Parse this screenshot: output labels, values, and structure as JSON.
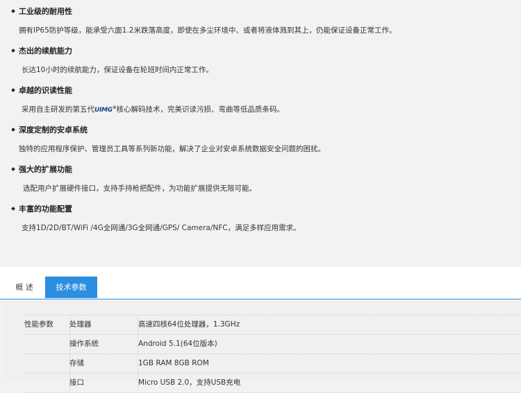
{
  "features": [
    {
      "title": "工业级的耐用性",
      "desc": "拥有IP65防护等级，能承受六面1.2米跌落高度，即使在多尘环境中、或者将液体溅到其上，仍能保证设备正常工作。"
    },
    {
      "title": "杰出的续航能力",
      "desc": "长达10小时的续航能力，保证设备在轮班时间内正常工作。"
    },
    {
      "title": "卓越的识读性能",
      "desc_prefix": "采用自主研发的第五代",
      "logo_text": "UIMG",
      "logo_mark": "®",
      "desc_suffix": "核心解码技术，完美识读污损、弯曲等低品质条码。"
    },
    {
      "title": "深度定制的安卓系统",
      "desc": "独特的应用程序保护、管理员工具等系列新功能，解决了企业对安卓系统数据安全问题的困扰。"
    },
    {
      "title": "强大的扩展功能",
      "desc": "选配用户扩展硬件接口，支持手持枪把配件，为功能扩展提供无限可能。"
    },
    {
      "title": "丰富的功能配置",
      "desc": "支持1D/2D/BT/WiFi /4G全网通/3G全网通/GPS/ Camera/NFC，满足多样应用需求。"
    }
  ],
  "tabs": [
    {
      "label": "概 述",
      "active": false
    },
    {
      "label": "技术参数",
      "active": true
    }
  ],
  "colors": {
    "accent": "#2c8ee0",
    "logo": "#1d3f8f"
  },
  "specs": {
    "category": "性能参数",
    "rows": [
      {
        "key": "处理器",
        "value": "高速四核64位处理器，1.3GHz"
      },
      {
        "key": "操作系统",
        "value": "Android 5.1(64位版本)"
      },
      {
        "key": "存储",
        "value": "1GB RAM  8GB ROM"
      },
      {
        "key": "接口",
        "value": "Micro USB 2.0，支持USB充电"
      }
    ]
  }
}
